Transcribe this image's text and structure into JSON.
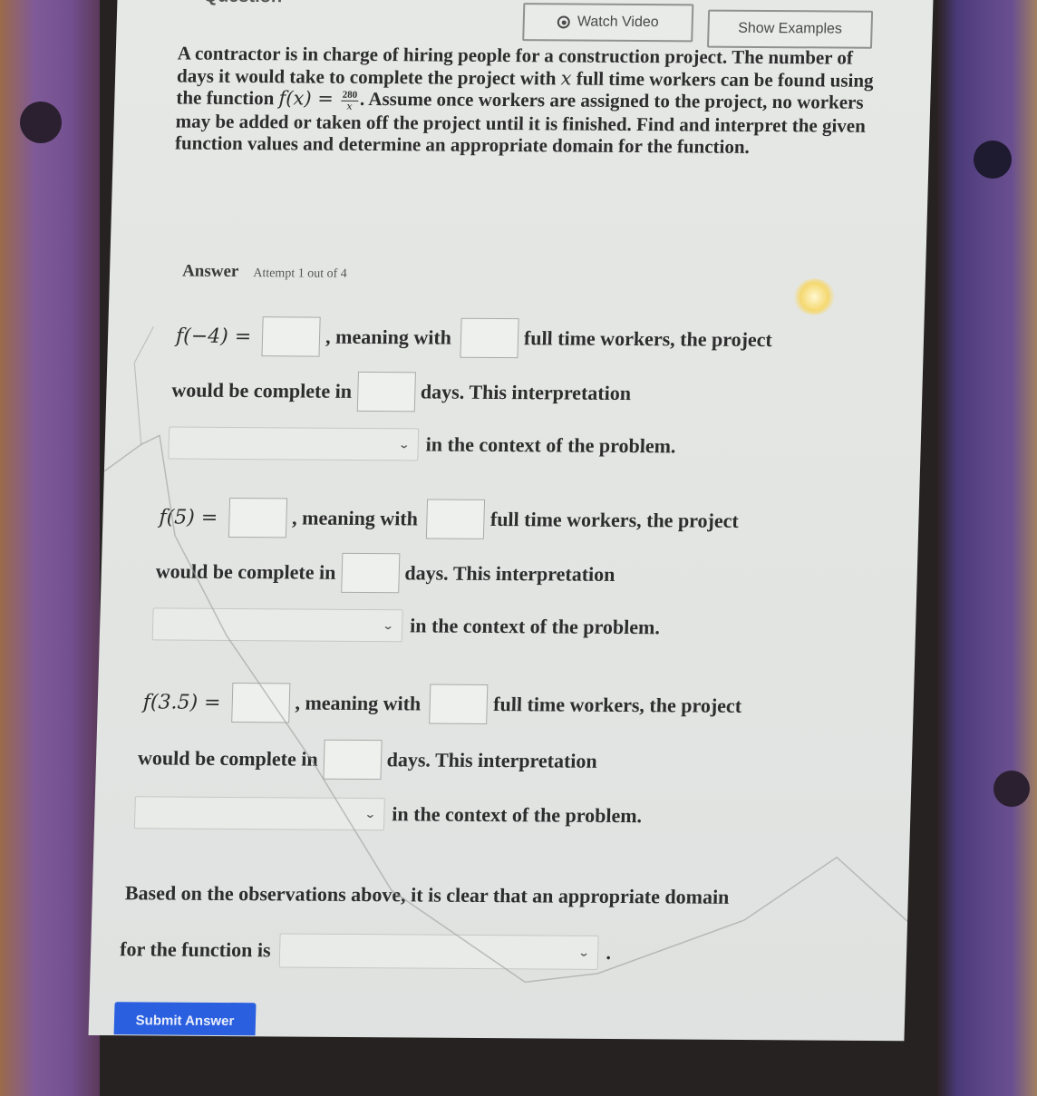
{
  "header": {
    "partial_title": "Question",
    "watch_video_label": "Watch Video",
    "show_examples_label": "Show Examples"
  },
  "problem": {
    "text_before": "A contractor is in charge of hiring people for a construction project. The number of days it would take to complete the project with ",
    "var": "x",
    "text_mid": " full time workers can be found using the function ",
    "func_lhs": "f(x) = ",
    "func_num": "280",
    "func_den": "x",
    "text_after": ". Assume once workers are assigned to the project, no workers may be added or taken off the project until it is finished. Find and interpret the given function values and determine an appropriate domain for the function."
  },
  "answer": {
    "label": "Answer",
    "attempt": "Attempt 1 out of 4"
  },
  "items": [
    {
      "fx": "f(−4) =",
      "value": "",
      "workers": "",
      "days": "",
      "interpretation": ""
    },
    {
      "fx": "f(5) =",
      "value": "",
      "workers": "",
      "days": "",
      "interpretation": ""
    },
    {
      "fx": "f(3.5) =",
      "value": "",
      "workers": "",
      "days": "",
      "interpretation": ""
    }
  ],
  "phrases": {
    "meaning_with": ", meaning with",
    "full_time": "full time workers, the project",
    "complete_in": "would be complete in",
    "days_interp": "days. This interpretation",
    "context": "in the context of the problem."
  },
  "domain": {
    "sentence_1": "Based on the observations above, it is clear that an appropriate domain",
    "sentence_2": "for the function is",
    "period": ".",
    "selected": ""
  },
  "submit_label": "Submit Answer",
  "colors": {
    "submit": "#2a5fe0",
    "screen_bg": "#e4e6e4",
    "case": "#74528f"
  }
}
